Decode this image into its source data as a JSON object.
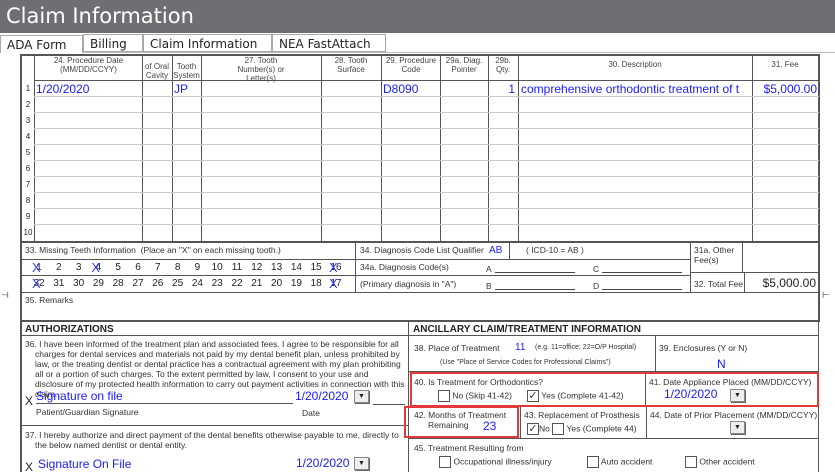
{
  "window": {
    "title": "Claim Information"
  },
  "tabs": [
    {
      "label": "ADA Form",
      "active": true
    },
    {
      "label": "Billing"
    },
    {
      "label": "Claim Information"
    },
    {
      "label": "NEA FastAttach"
    }
  ],
  "table": {
    "headers": {
      "date": "24. Procedure Date (MM/DD/CCYY)",
      "oral": "of Oral Cavity",
      "system": "Tooth System",
      "tooth": "27. Tooth Number(s) or Letter(s)",
      "surface": "28. Tooth Surface",
      "code": "29. Procedure Code",
      "pointer": "29a. Diag. Pointer",
      "qty": "29b. Qty.",
      "desc": "30. Description",
      "fee": "31. Fee"
    },
    "rows": [
      {
        "n": "1",
        "date": "1/20/2020",
        "system": "JP",
        "code": "D8090",
        "qty": "1",
        "desc": "comprehensive orthodontic treatment of t",
        "fee": "$5,000.00"
      },
      {
        "n": "2"
      },
      {
        "n": "3"
      },
      {
        "n": "4"
      },
      {
        "n": "5"
      },
      {
        "n": "6"
      },
      {
        "n": "7"
      },
      {
        "n": "8"
      },
      {
        "n": "9"
      },
      {
        "n": "10"
      }
    ]
  },
  "missing_teeth": {
    "label": "33. Missing Teeth Information",
    "hint": "(Place an \"X\" on each missing tooth.)",
    "upper": [
      "1",
      "2",
      "3",
      "4",
      "5",
      "6",
      "7",
      "8",
      "9",
      "10",
      "11",
      "12",
      "13",
      "14",
      "15",
      "16"
    ],
    "lower": [
      "32",
      "31",
      "30",
      "29",
      "28",
      "27",
      "26",
      "25",
      "24",
      "23",
      "22",
      "21",
      "20",
      "19",
      "18",
      "17"
    ],
    "marked": [
      "1",
      "4",
      "16",
      "32",
      "17"
    ]
  },
  "diagnosis": {
    "qualifier_label": "34. Diagnosis Code List Qualifier",
    "qualifier": "AB",
    "icd_note": "( ICD-10 = AB )",
    "codes_label": "34a. Diagnosis Code(s)",
    "primary_note": "(Primary diagnosis in \"A\")",
    "a": "A",
    "b": "B",
    "c": "C",
    "d": "D"
  },
  "fees": {
    "other_label": "31a. Other Fee(s)",
    "total_label": "32. Total Fee",
    "total": "$5,000.00"
  },
  "remarks_label": "35. Remarks",
  "authorizations": {
    "title": "AUTHORIZATIONS",
    "text36": "36. I have been informed of the treatment plan and associated fees. I agree to be responsible for all charges for dental services and materials not paid by my dental benefit plan, unless prohibited by law, or the treating dentist or dental practice has a contractual agreement with my plan prohibiting all or a portion of such charges. To the extent permitted by law, I consent to your use and disclosure of my protected health information to carry out payment activities in connection with this claim.",
    "x": "X",
    "sig1": "Signature on file",
    "date1": "1/20/2020",
    "sig_label": "Patient/Guardian Signature",
    "date_label": "Date",
    "text37": "37. I hereby authorize and direct payment of the dental benefits otherwise payable to me, directly to the below named dentist or dental entity.",
    "sig2": "Signature On File",
    "date2": "1/20/2020"
  },
  "ancillary": {
    "title": "ANCILLARY CLAIM/TREATMENT INFORMATION",
    "place_label": "38. Place of Treatment",
    "place": "11",
    "place_hint": "(e.g. 11=office; 22=O/P Hospital)",
    "place_note": "(Use \"Place of Service Codes for Professional Claims\")",
    "encl_label": "39. Enclosures (Y or N)",
    "encl": "N",
    "ortho_label": "40. Is Treatment for Orthodontics?",
    "ortho_no": "No  (Skip 41-42)",
    "ortho_yes": "Yes (Complete 41-42)",
    "ortho_value": "Yes",
    "appliance_label": "41. Date Appliance Placed (MM/DD/CCYY)",
    "appliance_date": "1/20/2020",
    "months_label": "42. Months of Treatment",
    "months_label2": "Remaining",
    "months": "23",
    "prosthesis_label": "43. Replacement of Prosthesis",
    "pros_no": "No",
    "pros_yes": "Yes (Complete 44)",
    "pros_value": "No",
    "prior_label": "44. Date of Prior Placement (MM/DD/CCYY)",
    "result_label": "45. Treatment Resulting from",
    "occ": "Occupational illness/injury",
    "auto": "Auto accident",
    "other": "Other accident"
  },
  "colors": {
    "value_text": "#1a1aff",
    "highlight": "#e03a3a",
    "titlebar": "#6f6e73"
  }
}
